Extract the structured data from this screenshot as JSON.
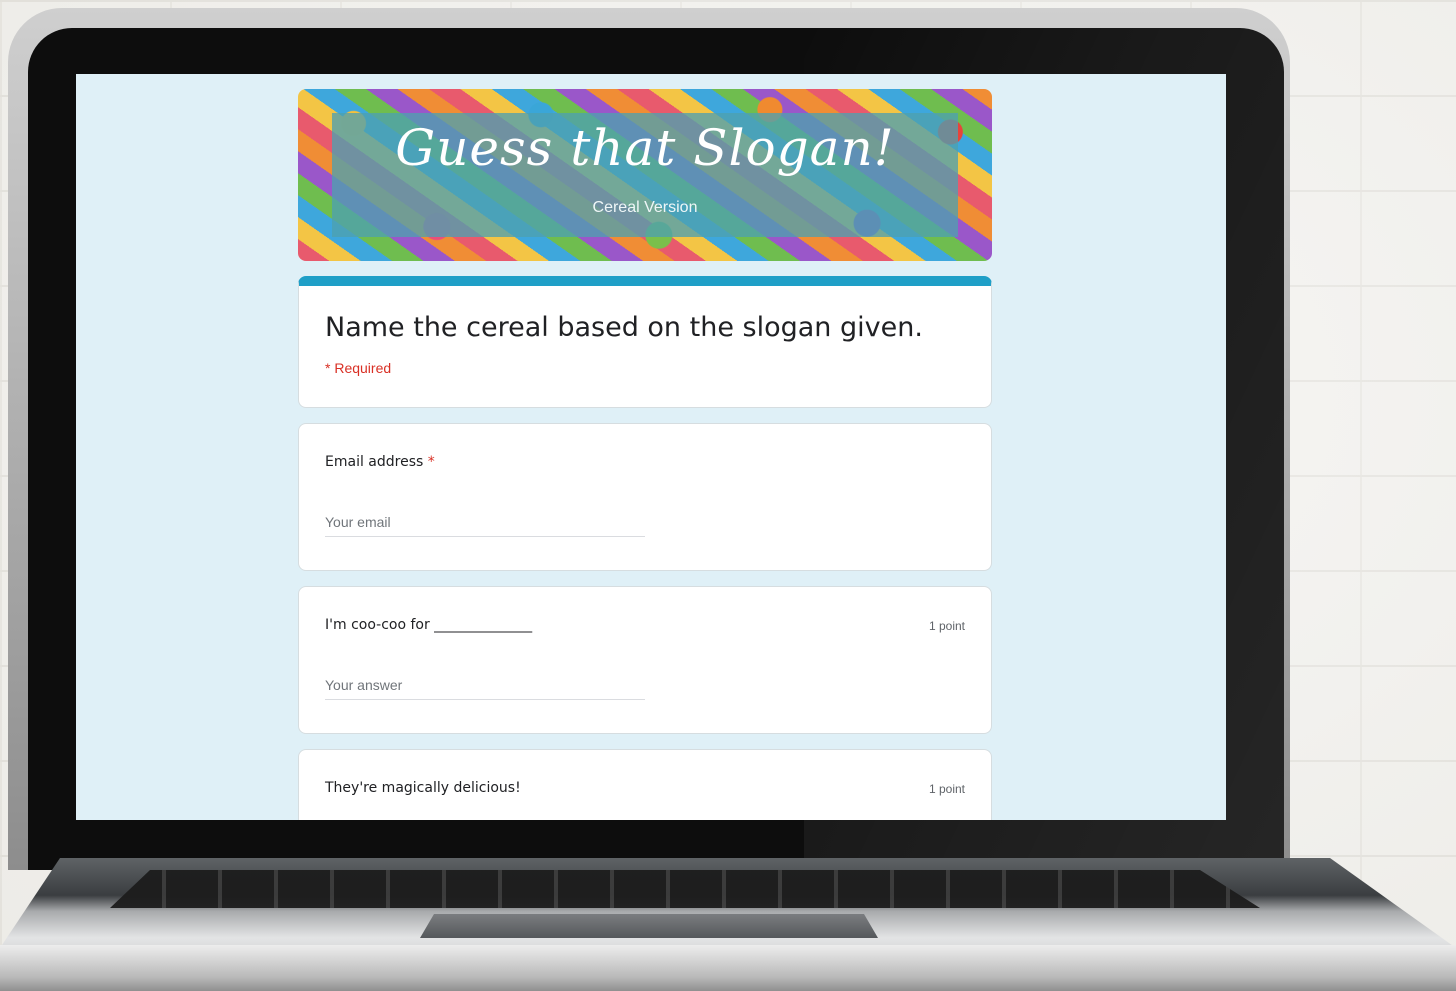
{
  "form": {
    "banner": {
      "title": "Guess that Slogan!",
      "subtitle": "Cereal Version"
    },
    "header": {
      "title": "Name the cereal based on the slogan given.",
      "required_note": "* Required"
    },
    "questions": [
      {
        "label": "Email address",
        "required_mark": "*",
        "placeholder": "Your email",
        "points": ""
      },
      {
        "label": "I'm coo-coo for ______________",
        "required_mark": "",
        "placeholder": "Your answer",
        "points": "1 point"
      },
      {
        "label": "They're magically delicious!",
        "required_mark": "",
        "placeholder": "",
        "points": "1 point"
      }
    ]
  },
  "colors": {
    "accent": "#1f9fc7",
    "required": "#d93025",
    "screen_bg": "#dff0f7"
  }
}
